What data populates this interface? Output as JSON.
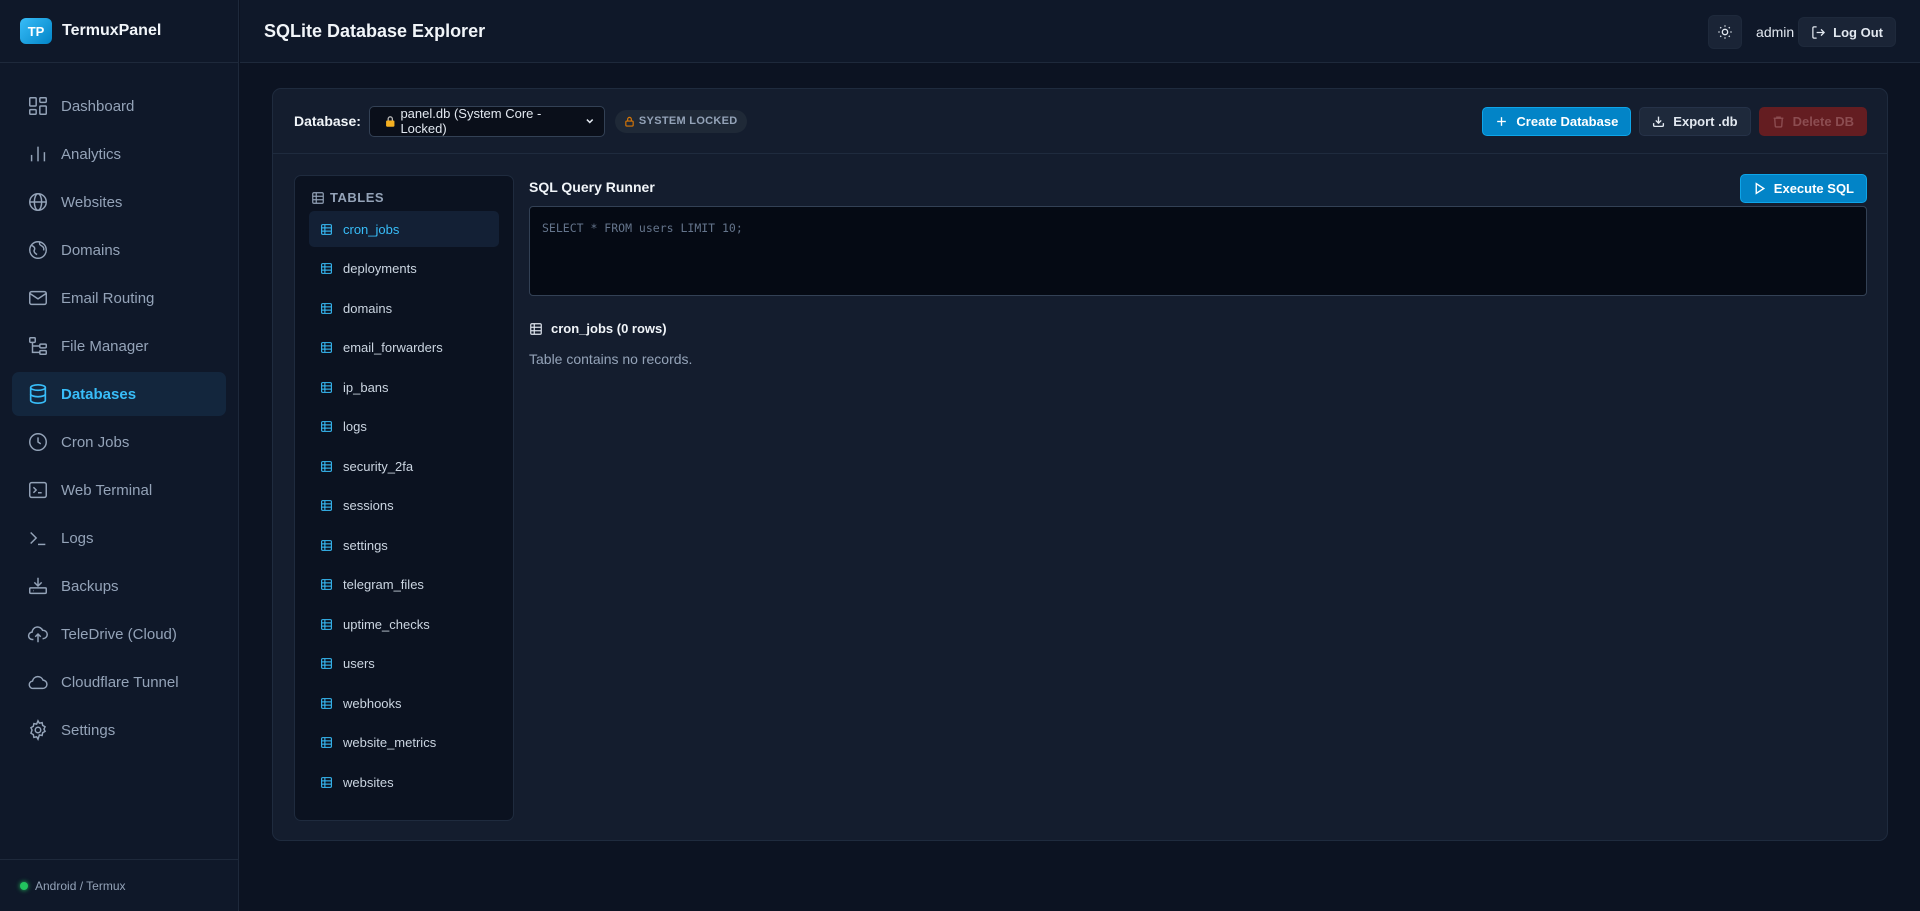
{
  "brand": {
    "logo": "TP",
    "name": "TermuxPanel"
  },
  "nav": {
    "items": [
      {
        "label": "Dashboard",
        "icon": "dashboard-icon"
      },
      {
        "label": "Analytics",
        "icon": "analytics-icon"
      },
      {
        "label": "Websites",
        "icon": "globe-icon"
      },
      {
        "label": "Domains",
        "icon": "domains-icon"
      },
      {
        "label": "Email Routing",
        "icon": "mail-icon"
      },
      {
        "label": "File Manager",
        "icon": "file-tree-icon"
      },
      {
        "label": "Databases",
        "icon": "database-icon",
        "active": true
      },
      {
        "label": "Cron Jobs",
        "icon": "clock-icon"
      },
      {
        "label": "Web Terminal",
        "icon": "terminal-icon"
      },
      {
        "label": "Logs",
        "icon": "prompt-icon"
      },
      {
        "label": "Backups",
        "icon": "backup-icon"
      },
      {
        "label": "TeleDrive (Cloud)",
        "icon": "cloud-upload-icon"
      },
      {
        "label": "Cloudflare Tunnel",
        "icon": "cloud-icon"
      },
      {
        "label": "Settings",
        "icon": "gear-icon"
      }
    ]
  },
  "footer": {
    "status": "Android / Termux",
    "status_color": "#22c55e"
  },
  "header": {
    "title": "SQLite Database Explorer",
    "user": "admin",
    "logout_label": "Log Out"
  },
  "toolbar": {
    "db_label": "Database:",
    "db_selected": "panel.db (System Core - Locked)",
    "locked_badge": "SYSTEM LOCKED",
    "create_label": "Create Database",
    "export_label": "Export .db",
    "delete_label": "Delete DB"
  },
  "tables": {
    "header": "TABLES",
    "items": [
      "cron_jobs",
      "deployments",
      "domains",
      "email_forwarders",
      "ip_bans",
      "logs",
      "security_2fa",
      "sessions",
      "settings",
      "telegram_files",
      "uptime_checks",
      "users",
      "webhooks",
      "website_metrics",
      "websites"
    ],
    "active": "cron_jobs"
  },
  "query": {
    "title": "SQL Query Runner",
    "execute_label": "Execute SQL",
    "placeholder": "SELECT * FROM users LIMIT 10;"
  },
  "result": {
    "title": "cron_jobs (0 rows)",
    "empty_message": "Table contains no records."
  },
  "colors": {
    "accent": "#38bdf8",
    "primary": "#0284c7",
    "danger": "#7f1d1d",
    "background": "#0c1322"
  }
}
